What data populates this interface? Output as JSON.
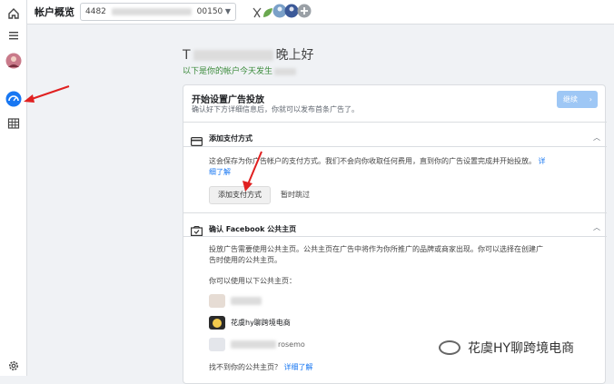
{
  "header": {
    "title": "帐户概览",
    "account_prefix": "4482",
    "account_suffix": "00150"
  },
  "greeting": {
    "prefix": "T",
    "suffix": "晚上好",
    "sub_prefix": "以下是你的帐户今天发生",
    "sub_color": "#3a8a3a"
  },
  "setup_card": {
    "title": "开始设置广告投放",
    "subtitle": "确认好下方详细信息后，你就可以发布首条广告了。",
    "continue_label": "继续",
    "continue_color": "#9ec7f5"
  },
  "payment_section": {
    "title": "添加支付方式",
    "description_line1": "这会保存为你广告帐户的支付方式。我们不会向你收取任何费用，直到你的广告设置完成并开始投放。",
    "learn_more_a": "详",
    "learn_more_b": "细了解",
    "add_button": "添加支付方式",
    "skip_label": "暂时跳过"
  },
  "page_section": {
    "title": "确认 Facebook 公共主页",
    "description_line1": "投放广告需要使用公共主页。公共主页在广告中将作为你所推广的品牌或商家出现。你可以选择在创建广",
    "description_line2": "告时使用的公共主页。",
    "available_label": "你可以使用以下公共主页：",
    "pages": [
      {
        "name": ""
      },
      {
        "name": "花虞hy聊跨境电商"
      },
      {
        "name": "rosemo"
      }
    ],
    "not_found": "找不到你的公共主页？",
    "learn_more": "详细了解"
  },
  "watermark": {
    "text": "花虞HY聊跨境电商"
  },
  "icons": {
    "home": "home-icon",
    "menu": "menu-icon",
    "avatar": "avatar",
    "ads_manager": "ads-manager-icon",
    "table": "table-icon",
    "settings": "gear-icon"
  },
  "accent_color": "#1877f2",
  "arrow_color": "#e02020"
}
